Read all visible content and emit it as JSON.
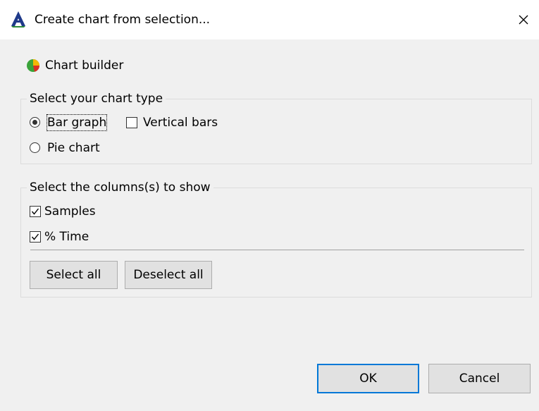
{
  "window": {
    "title": "Create chart from selection...",
    "app_icon": "app-logo-icon",
    "close_icon": "close-icon"
  },
  "header": {
    "icon": "pie-chart-icon",
    "text": "Chart builder"
  },
  "chart_type_group": {
    "legend": "Select your chart type",
    "options": [
      {
        "label": "Bar graph",
        "selected": true
      },
      {
        "label": "Pie chart",
        "selected": false
      }
    ],
    "vertical_bars": {
      "label": "Vertical bars",
      "checked": false
    }
  },
  "columns_group": {
    "legend": "Select the columns(s) to show",
    "columns": [
      {
        "label": "Samples",
        "checked": true
      },
      {
        "label": "% Time",
        "checked": true
      }
    ],
    "select_all_label": "Select all",
    "deselect_all_label": "Deselect all"
  },
  "footer": {
    "ok_label": "OK",
    "cancel_label": "Cancel"
  },
  "colors": {
    "accent": "#0078d7",
    "window_bg": "#f0f0f0",
    "titlebar_bg": "#ffffff"
  }
}
